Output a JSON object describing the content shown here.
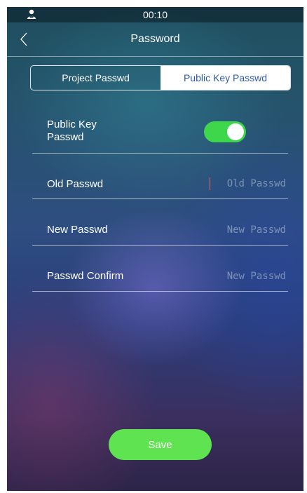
{
  "status_bar": {
    "time": "00:10",
    "icon": "user-icon"
  },
  "nav": {
    "title": "Password",
    "back_icon": "chevron-left-icon"
  },
  "tabs": [
    {
      "label": "Project Passwd",
      "active": false
    },
    {
      "label": "Public Key Passwd",
      "active": true
    }
  ],
  "form": {
    "public_key": {
      "label_line1": "Public Key",
      "label_line2": "Passwd",
      "enabled": true
    },
    "old_passwd": {
      "label": "Old Passwd",
      "placeholder": "Old Passwd",
      "value": ""
    },
    "new_passwd": {
      "label": "New Passwd",
      "placeholder": "New Passwd",
      "value": ""
    },
    "confirm_passwd": {
      "label": "Passwd Confirm",
      "placeholder": "New Passwd",
      "value": ""
    }
  },
  "save_label": "Save",
  "colors": {
    "accent_green": "#5fe350",
    "toggle_on": "#3ed64a",
    "active_tab_text": "#2f5aa8",
    "caret": "#e06a6a"
  }
}
